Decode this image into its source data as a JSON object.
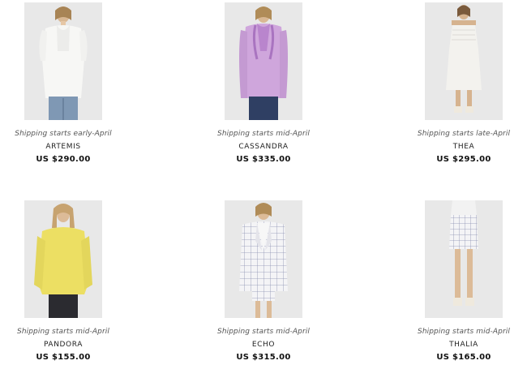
{
  "products": [
    {
      "shipping": "Shipping starts early-April",
      "name": "ARTEMIS",
      "price": "US $290.00",
      "image": "model-white-ruffle-blouse"
    },
    {
      "shipping": "Shipping starts mid-April",
      "name": "CASSANDRA",
      "price": "US $335.00",
      "image": "model-lilac-ruffle-blouse"
    },
    {
      "shipping": "Shipping starts late-April",
      "name": "THEA",
      "price": "US $295.00",
      "image": "model-white-smocked-dress"
    },
    {
      "shipping": "Shipping starts mid-April",
      "name": "PANDORA",
      "price": "US $155.00",
      "image": "model-yellow-sweatshirt"
    },
    {
      "shipping": "Shipping starts mid-April",
      "name": "ECHO",
      "price": "US $315.00",
      "image": "model-check-blazer"
    },
    {
      "shipping": "Shipping starts mid-April",
      "name": "THALIA",
      "price": "US $165.00",
      "image": "model-check-mini-skirt"
    }
  ],
  "colors": {
    "photo_background": "#e9e9e9",
    "text": "#1a1a1a",
    "shipping_text": "#555555"
  }
}
